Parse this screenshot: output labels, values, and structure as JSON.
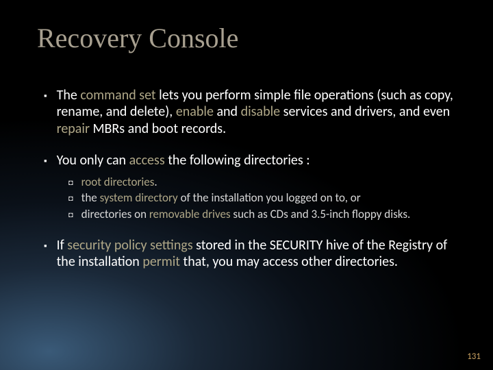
{
  "title": "Recovery Console",
  "bullets": {
    "b1": {
      "pre": "The ",
      "a1": "command set ",
      "mid1": "lets you perform simple file operations (such as copy, rename, and delete), ",
      "a2": "enable ",
      "mid2": "and ",
      "a3": "disable ",
      "mid3": "services and drivers, and even ",
      "a4": "repair ",
      "post": "MBRs and boot records."
    },
    "b2": {
      "pre": "You only can ",
      "a1": "access ",
      "post": "the following directories :"
    },
    "sub": {
      "s1": {
        "a1": "root directories",
        "post": "."
      },
      "s2": {
        "pre": "the ",
        "a1": "system directory ",
        "post": "of the installation you logged on to, or"
      },
      "s3": {
        "pre": "directories on ",
        "a1": "removable drives ",
        "post": "such as CDs and 3.5-inch floppy disks."
      }
    },
    "b3": {
      "pre": "If ",
      "a1": "security policy settings ",
      "mid1": "stored in the SECURITY hive of the Registry of the installation ",
      "a2": "permit ",
      "post": "that, you may access other directories."
    }
  },
  "page": "131"
}
